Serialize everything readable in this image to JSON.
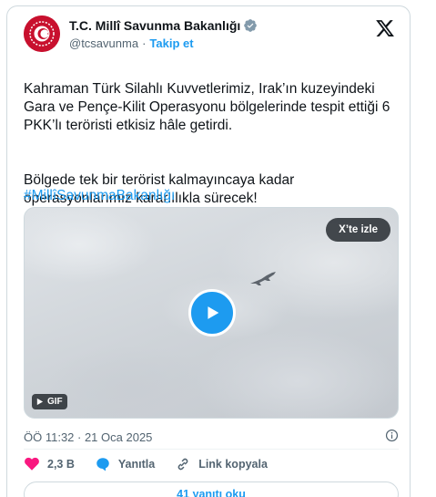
{
  "account": {
    "name": "T.C. Millî Savunma Bakanlığı",
    "handle": "@tcsavunma",
    "separator": "·",
    "follow_label": "Takip et"
  },
  "tweet": {
    "paragraph1": "Kahraman Türk Silahlı Kuvvetlerimiz, Irak’ın kuzeyindeki Gara ve Pençe-Kilit Operasyonu bölgelerinde tespit ettiği 6 PKK’lı teröristi etkisiz hâle getirdi.",
    "paragraph2": "Bölgede tek bir terörist kalmayıncaya kadar operasyonlarımız kararlılıkla sürecek!",
    "hashtag": "#MillîSavunmaBakanlığı"
  },
  "media": {
    "watch_label": "X’te izle",
    "badge_label": "GIF"
  },
  "meta": {
    "timestamp": "ÖÖ 11:32 · 21 Oca 2025"
  },
  "actions": {
    "likes": "2,3 B",
    "reply_label": "Yanıtla",
    "copy_link_label": "Link kopyala"
  },
  "replies_button": "41 yanıtı oku",
  "colors": {
    "accent": "#1d9bf0",
    "like": "#f91880",
    "brand_red": "#c8102e"
  },
  "icons": {
    "x_logo": "x-logo-icon",
    "verified": "verified-badge-icon",
    "play": "play-icon",
    "heart": "heart-icon",
    "reply": "reply-bubble-icon",
    "link": "link-icon",
    "info": "info-icon"
  }
}
